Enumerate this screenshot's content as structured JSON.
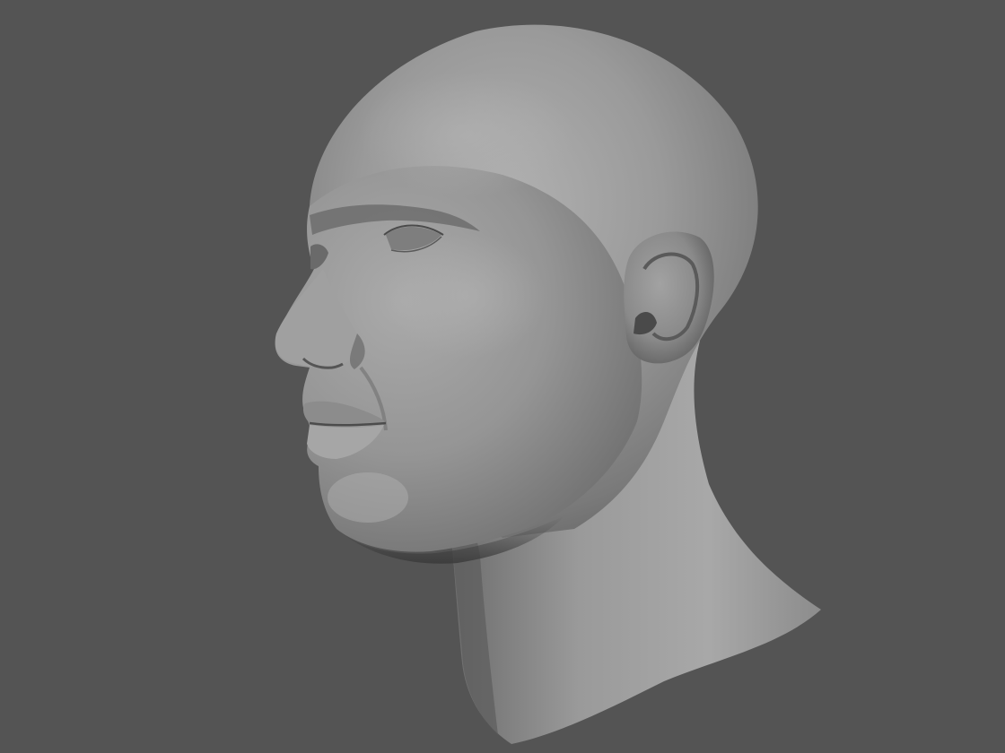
{
  "scene": {
    "background_color": "#545454",
    "subject": "sculpted-head",
    "material": "matte-gray-clay",
    "view": "three-quarter-left"
  },
  "colors": {
    "clay_light": "#a6a6a6",
    "clay_mid": "#8a8a8a",
    "clay_dark": "#5c5c5c",
    "clay_shadow": "#3e3e3e"
  }
}
